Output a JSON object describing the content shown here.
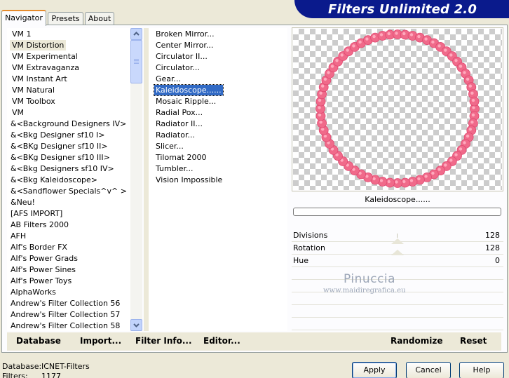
{
  "app": {
    "title": "Filters Unlimited 2.0"
  },
  "tabs": [
    {
      "label": "Navigator",
      "active": true
    },
    {
      "label": "Presets",
      "active": false
    },
    {
      "label": "About",
      "active": false
    }
  ],
  "categories": {
    "selected": "VM Distortion",
    "items": [
      "VM 1",
      "VM Distortion",
      "VM Experimental",
      "VM Extravaganza",
      "VM Instant Art",
      "VM Natural",
      "VM Toolbox",
      "VM",
      "&<Background Designers IV>",
      "&<Bkg Designer sf10 I>",
      "&<BKg Designer sf10 II>",
      "&<BKg Designer sf10 III>",
      "&<Bkg Designers sf10 IV>",
      "&<Bkg Kaleidoscope>",
      "&<Sandflower Specials^v^ >",
      "&Neu!",
      "[AFS IMPORT]",
      "AB Filters 2000",
      "AFH",
      "Alf's Border FX",
      "Alf's Power Grads",
      "Alf's Power Sines",
      "Alf's Power Toys",
      "AlphaWorks",
      "Andrew's Filter Collection 56",
      "Andrew's Filter Collection 57",
      "Andrew's Filter Collection 58"
    ]
  },
  "filters": {
    "selected": "Kaleidoscope......",
    "items": [
      "Broken Mirror...",
      "Center Mirror...",
      "Circulator II...",
      "Circulator...",
      "Gear...",
      "Kaleidoscope......",
      "Mosaic Ripple...",
      "Radial Pox...",
      "Radiator II...",
      "Radiator...",
      "Slicer...",
      "Tilomat 2000",
      "Tumbler...",
      "Vision Impossible"
    ]
  },
  "preview": {
    "filter_name": "Kaleidoscope......",
    "ring_color": "#f06a8a",
    "progress": 0
  },
  "params": [
    {
      "label": "Divisions",
      "value": "128"
    },
    {
      "label": "Rotation",
      "value": "128"
    },
    {
      "label": "Hue",
      "value": "0"
    }
  ],
  "watermark": {
    "name": "Pinuccia",
    "site": "www.maidiregrafica.eu"
  },
  "toolbar": {
    "database": "Database",
    "import": "Import...",
    "filter_info": "Filter Info...",
    "editor": "Editor...",
    "randomize": "Randomize",
    "reset": "Reset"
  },
  "status": {
    "database_label": "Database:",
    "database_value": "ICNET-Filters",
    "filters_label": "Filters:",
    "filters_value": "1177"
  },
  "buttons": {
    "apply": "Apply",
    "cancel": "Cancel",
    "help": "Help"
  },
  "colors": {
    "banner": "#0a1a8c",
    "selection": "#316ac5",
    "tab_highlight": "#e68b2c"
  }
}
